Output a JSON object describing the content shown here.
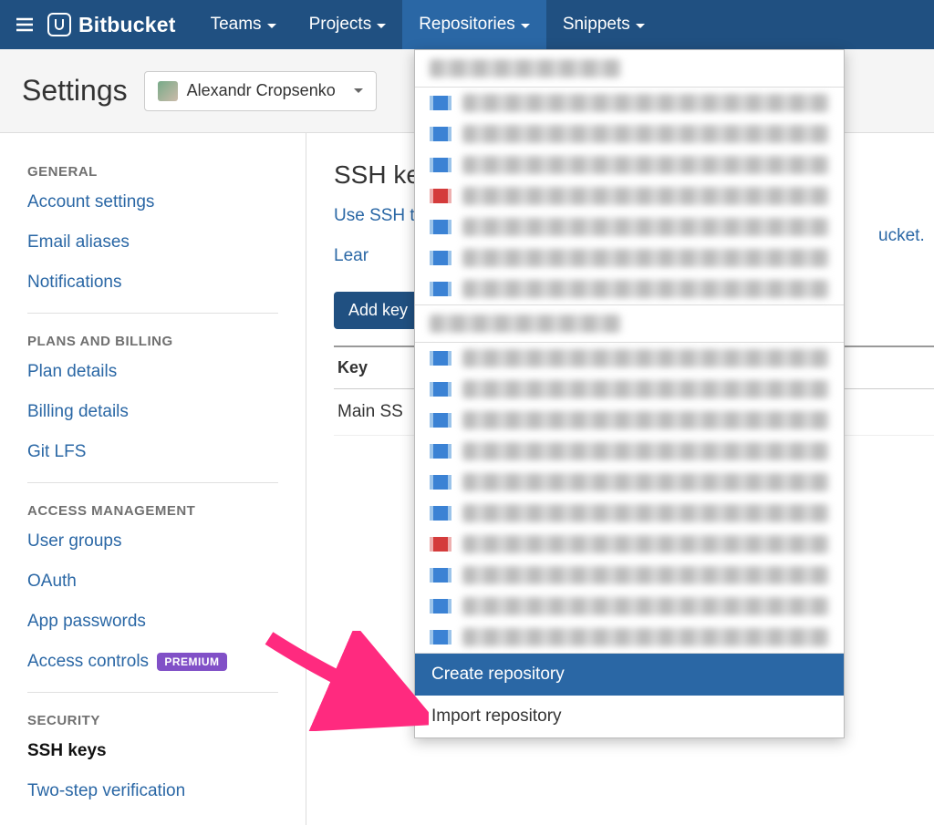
{
  "topnav": {
    "brand": "Bitbucket",
    "items": [
      {
        "label": "Teams"
      },
      {
        "label": "Projects"
      },
      {
        "label": "Repositories",
        "active": true
      },
      {
        "label": "Snippets"
      }
    ]
  },
  "subhead": {
    "page_title": "Settings",
    "account_name": "Alexandr Cropsenko"
  },
  "sidebar": {
    "sections": [
      {
        "title": "GENERAL",
        "items": [
          {
            "label": "Account settings"
          },
          {
            "label": "Email aliases"
          },
          {
            "label": "Notifications"
          }
        ]
      },
      {
        "title": "PLANS AND BILLING",
        "items": [
          {
            "label": "Plan details"
          },
          {
            "label": "Billing details"
          },
          {
            "label": "Git LFS"
          }
        ]
      },
      {
        "title": "ACCESS MANAGEMENT",
        "items": [
          {
            "label": "User groups"
          },
          {
            "label": "OAuth"
          },
          {
            "label": "App passwords"
          },
          {
            "label": "Access controls",
            "badge": "PREMIUM"
          }
        ]
      },
      {
        "title": "SECURITY",
        "items": [
          {
            "label": "SSH keys",
            "active": true
          },
          {
            "label": "Two-step verification"
          }
        ]
      }
    ]
  },
  "main": {
    "heading": "SSH keys",
    "desc_prefix": "Use SSH t",
    "desc_suffix": "ucket. Lear",
    "add_button": "Add key",
    "table_header": "Key",
    "rows": [
      "Main SS"
    ]
  },
  "dropdown": {
    "create_label": "Create repository",
    "import_label": "Import repository"
  }
}
